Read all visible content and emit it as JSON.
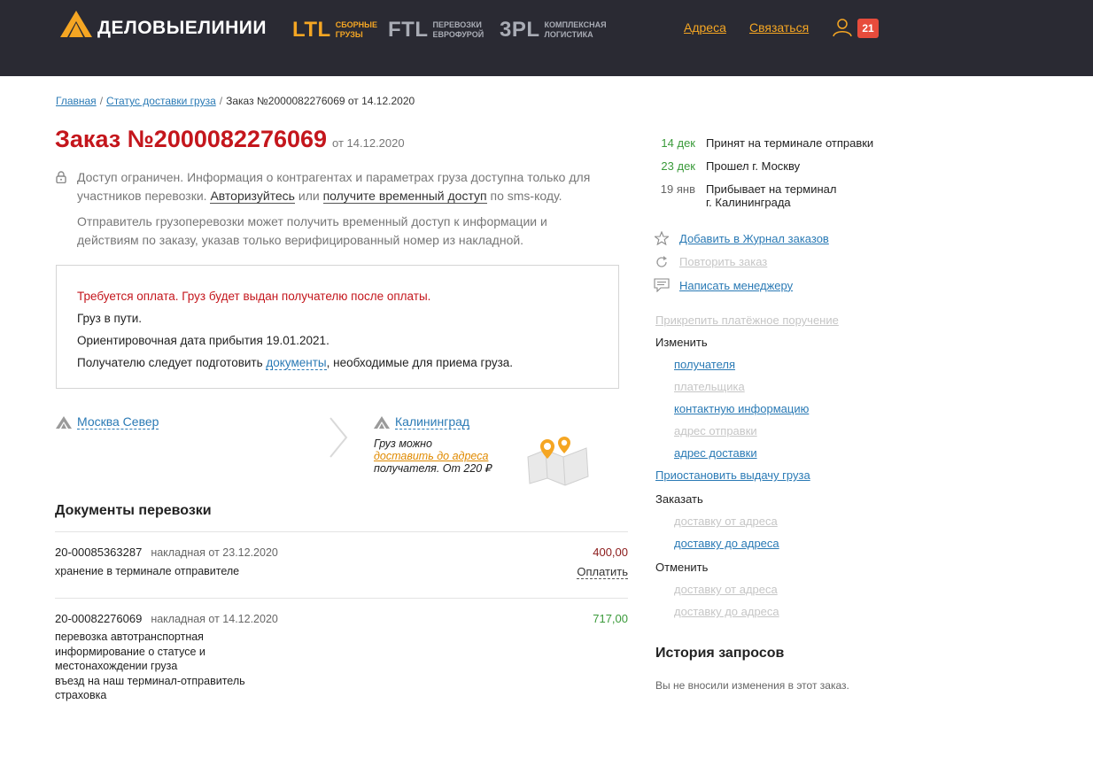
{
  "header": {
    "logo_text": "ДЕЛОВЫЕЛИНИИ",
    "services": [
      {
        "code": "LTL",
        "line1": "СБОРНЫЕ",
        "line2": "ГРУЗЫ"
      },
      {
        "code": "FTL",
        "line1": "ПЕРЕВОЗКИ",
        "line2": "ЕВРОФУРОЙ"
      },
      {
        "code": "3PL",
        "line1": "КОМПЛЕКСНАЯ",
        "line2": "ЛОГИСТИКА"
      }
    ],
    "links": {
      "addresses": "Адреса",
      "contact": "Связаться"
    },
    "notification_count": "21",
    "accent": "#f5a623",
    "background": "#2a2a33"
  },
  "breadcrumb": {
    "home": "Главная",
    "status": "Статус доставки груза",
    "current": "Заказ №2000082276069 от 14.12.2020"
  },
  "order": {
    "title": "Заказ №2000082276069",
    "date": "от 14.12.2020",
    "access": {
      "text1": "Доступ ограничен. Информация о контрагентах и параметрах груза доступна только для участников перевозки.",
      "login_link": "Авторизуйтесь",
      "or": "или",
      "temp_link": "получите временный доступ",
      "suffix": "по sms-коду.",
      "text2": "Отправитель грузоперевозки может получить временный доступ к информации и действиям по заказу, указав только верифицированный номер из накладной."
    },
    "status": {
      "warning": "Требуется оплата. Груз будет выдан получателю после оплаты.",
      "in_transit": "Груз в пути.",
      "eta": "Ориентировочная дата прибытия 19.01.2021.",
      "prepare_prefix": "Получателю следует подготовить",
      "prepare_link": "документы",
      "prepare_suffix": ", необходимые для приема груза."
    },
    "route": {
      "from": "Москва Север",
      "to": "Калининград",
      "note_line1": "Груз можно",
      "note_link": "доставить до адреса",
      "note_line3": "получателя. От 220 ₽"
    }
  },
  "documents": {
    "title": "Документы перевозки",
    "items": [
      {
        "number": "20-00085363287",
        "kind": "накладная от 23.12.2020",
        "lines": [
          "хранение в терминале отправителе"
        ],
        "amount": "400,00",
        "action": "Оплатить"
      },
      {
        "number": "20-00082276069",
        "kind": "накладная от 14.12.2020",
        "lines": [
          "перевозка автотранспортная",
          "информирование о статусе и",
          "местонахождении груза",
          "въезд на наш терминал-отправитель",
          "страховка"
        ],
        "amount": "717,00"
      }
    ]
  },
  "events": [
    {
      "date": "14 дек",
      "text": "Принят на терминале отправки",
      "state": "done"
    },
    {
      "date": "23 дек",
      "text": "Прошел г. Москву",
      "state": "done"
    },
    {
      "date": "19 янв",
      "text": "Прибывает на терминал",
      "text2": "г. Калининграда",
      "state": "planned"
    }
  ],
  "actions": [
    {
      "label": "Добавить в Журнал заказов",
      "icon": "star-icon",
      "enabled": true
    },
    {
      "label": "Повторить заказ",
      "icon": "repeat-icon",
      "enabled": false
    },
    {
      "label": "Написать менеджеру",
      "icon": "chat-icon",
      "enabled": true
    }
  ],
  "manage": {
    "attach_payment": "Прикрепить платёжное поручение",
    "change_label": "Изменить",
    "change": [
      "получателя",
      "плательщика",
      "контактную информацию",
      "адрес отправки",
      "адрес доставки"
    ],
    "suspend": "Приостановить выдачу груза",
    "order_label": "Заказать",
    "order": [
      "доставку от адреса",
      "доставку до адреса"
    ],
    "cancel_label": "Отменить",
    "cancel": [
      "доставку от адреса",
      "доставку до адреса"
    ]
  },
  "history": {
    "title": "История запросов",
    "text": "Вы не вносили изменения в этот заказ."
  }
}
